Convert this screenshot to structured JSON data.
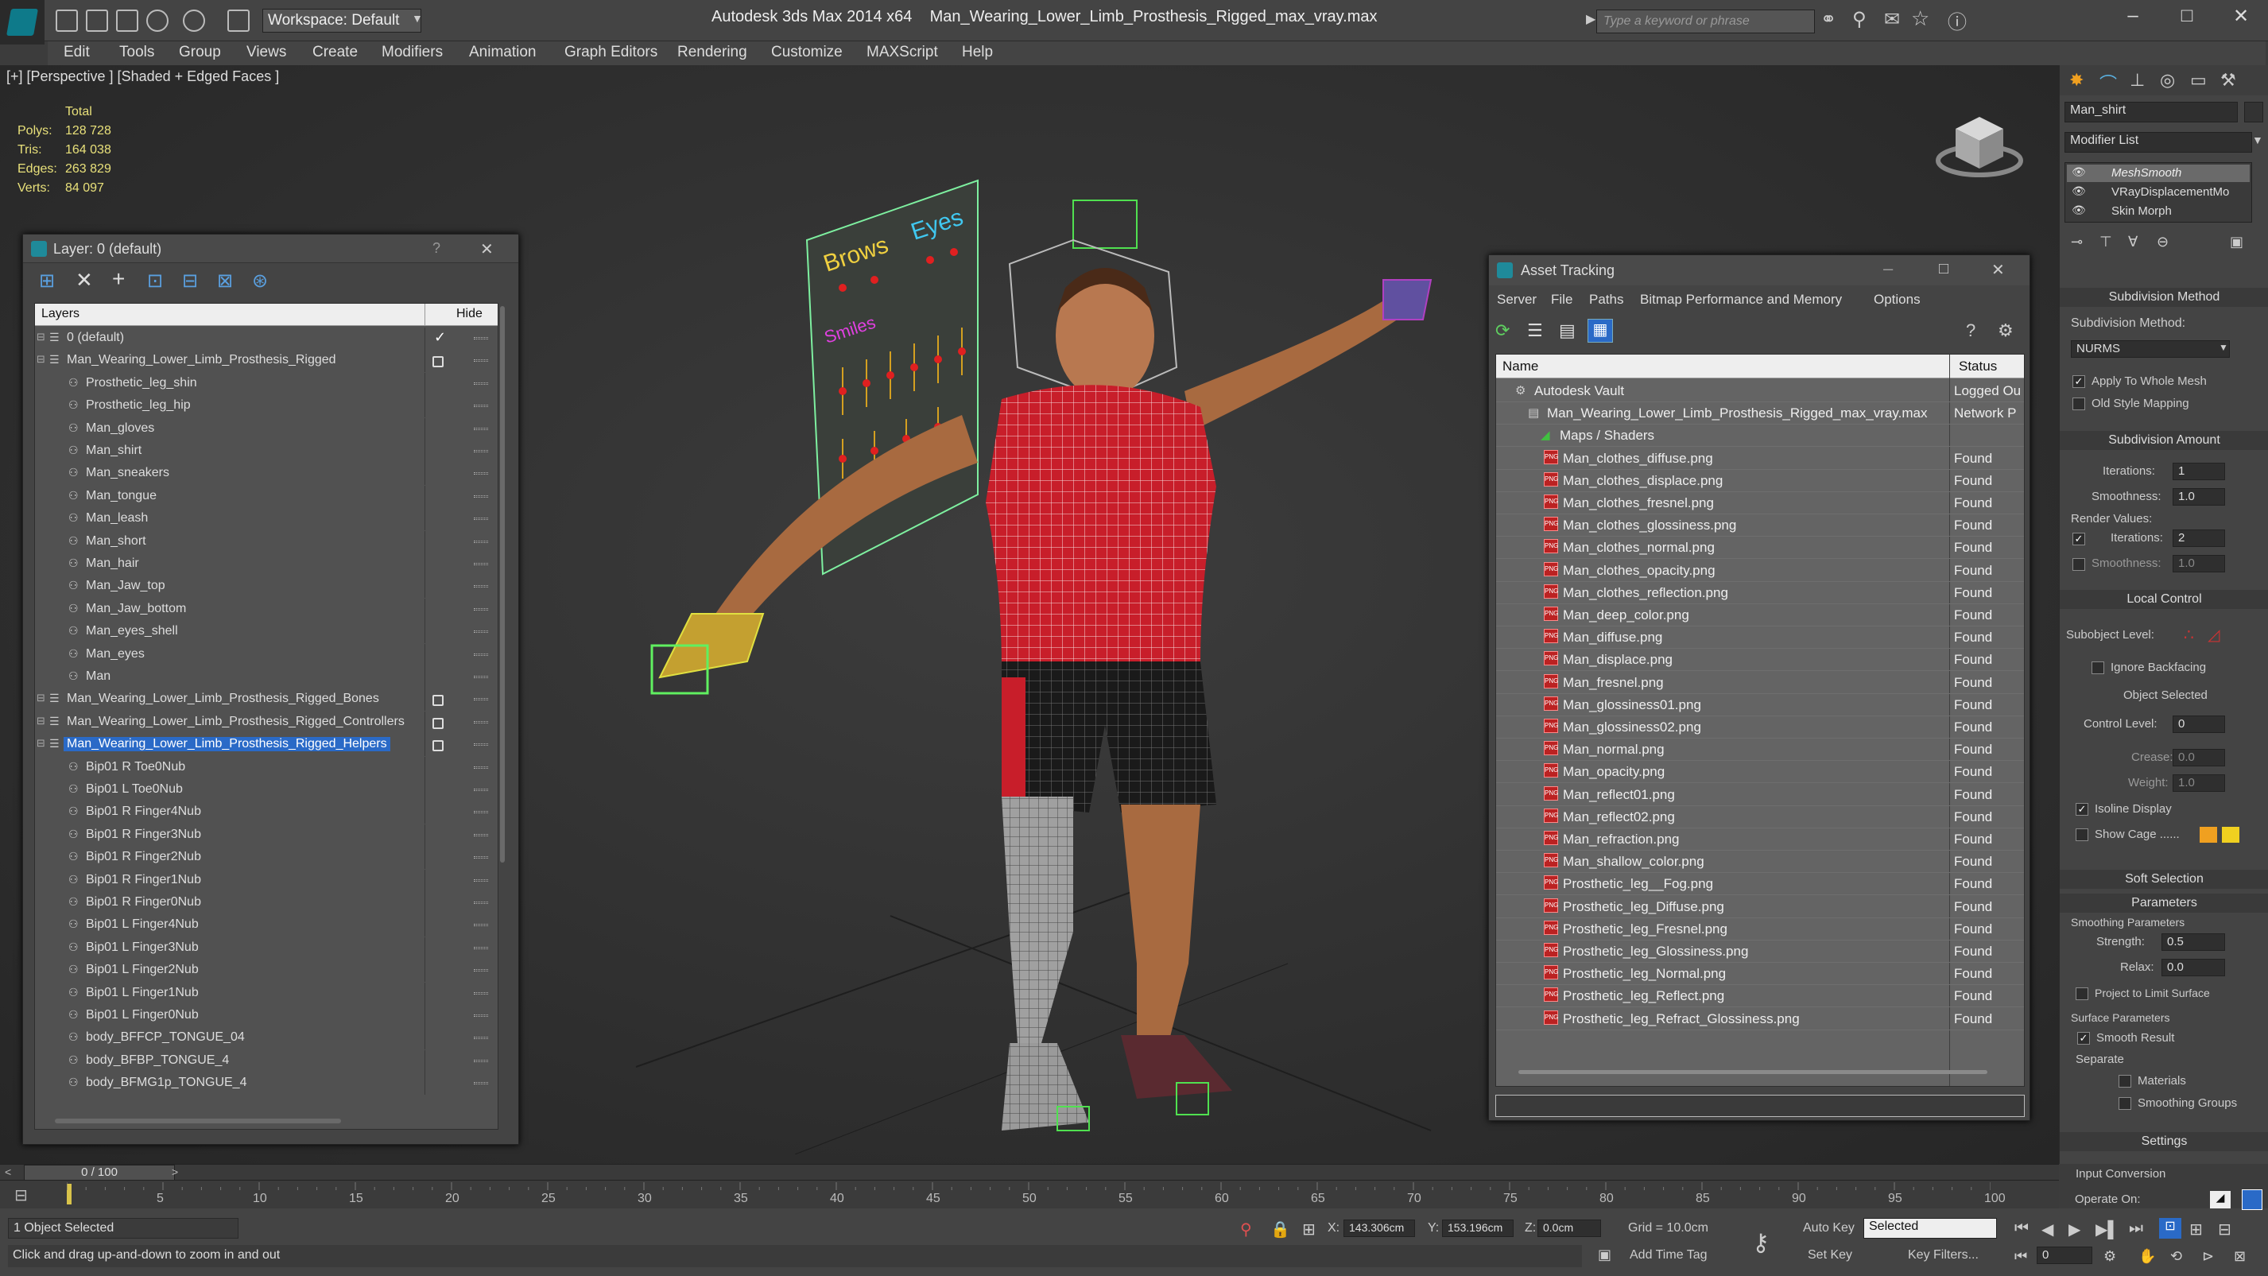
{
  "window": {
    "workspace_label": "Workspace: Default",
    "app_title": "Autodesk 3ds Max  2014 x64",
    "file_title": "Man_Wearing_Lower_Limb_Prosthesis_Rigged_max_vray.max",
    "search_placeholder": "Type a keyword or phrase"
  },
  "menubar": [
    "Edit",
    "Tools",
    "Group",
    "Views",
    "Create",
    "Modifiers",
    "Animation",
    "Graph Editors",
    "Rendering",
    "Customize",
    "MAXScript",
    "Help"
  ],
  "viewport": {
    "label": "[+] [Perspective ] [Shaded + Edged Faces ]",
    "stats": {
      "total_label": "Total",
      "rows": [
        {
          "label": "Polys:",
          "value": "128 728"
        },
        {
          "label": "Tris:",
          "value": "164 038"
        },
        {
          "label": "Edges:",
          "value": "263 829"
        },
        {
          "label": "Verts:",
          "value": "84 097"
        }
      ]
    },
    "face_board": {
      "brows": "Brows",
      "eyes": "Eyes",
      "smiles": "Smiles"
    }
  },
  "layer_window": {
    "title": "Layer: 0 (default)",
    "help": "?",
    "close": "✕",
    "col_layers": "Layers",
    "col_hide": "Hide",
    "rows": [
      {
        "name": "0 (default)",
        "level": 0,
        "check": true
      },
      {
        "name": "Man_Wearing_Lower_Limb_Prosthesis_Rigged",
        "level": 0,
        "box": true
      },
      {
        "name": "Prosthetic_leg_shin",
        "level": 1
      },
      {
        "name": "Prosthetic_leg_hip",
        "level": 1
      },
      {
        "name": "Man_gloves",
        "level": 1
      },
      {
        "name": "Man_shirt",
        "level": 1
      },
      {
        "name": "Man_sneakers",
        "level": 1
      },
      {
        "name": "Man_tongue",
        "level": 1
      },
      {
        "name": "Man_leash",
        "level": 1
      },
      {
        "name": "Man_short",
        "level": 1
      },
      {
        "name": "Man_hair",
        "level": 1
      },
      {
        "name": "Man_Jaw_top",
        "level": 1
      },
      {
        "name": "Man_Jaw_bottom",
        "level": 1
      },
      {
        "name": "Man_eyes_shell",
        "level": 1
      },
      {
        "name": "Man_eyes",
        "level": 1
      },
      {
        "name": "Man",
        "level": 1
      },
      {
        "name": "Man_Wearing_Lower_Limb_Prosthesis_Rigged_Bones",
        "level": 0,
        "box": true
      },
      {
        "name": "Man_Wearing_Lower_Limb_Prosthesis_Rigged_Controllers",
        "level": 0,
        "box": true
      },
      {
        "name": "Man_Wearing_Lower_Limb_Prosthesis_Rigged_Helpers",
        "level": 0,
        "box": true,
        "selected": true
      },
      {
        "name": "Bip01 R Toe0Nub",
        "level": 1
      },
      {
        "name": "Bip01 L Toe0Nub",
        "level": 1
      },
      {
        "name": "Bip01 R Finger4Nub",
        "level": 1
      },
      {
        "name": "Bip01 R Finger3Nub",
        "level": 1
      },
      {
        "name": "Bip01 R Finger2Nub",
        "level": 1
      },
      {
        "name": "Bip01 R Finger1Nub",
        "level": 1
      },
      {
        "name": "Bip01 R Finger0Nub",
        "level": 1
      },
      {
        "name": "Bip01 L Finger4Nub",
        "level": 1
      },
      {
        "name": "Bip01 L Finger3Nub",
        "level": 1
      },
      {
        "name": "Bip01 L Finger2Nub",
        "level": 1
      },
      {
        "name": "Bip01 L Finger1Nub",
        "level": 1
      },
      {
        "name": "Bip01 L Finger0Nub",
        "level": 1
      },
      {
        "name": "body_BFFCP_TONGUE_04",
        "level": 1
      },
      {
        "name": "body_BFBP_TONGUE_4",
        "level": 1
      },
      {
        "name": "body_BFMG1p_TONGUE_4",
        "level": 1
      }
    ]
  },
  "asset_window": {
    "title": "Asset Tracking",
    "menus": [
      "Server",
      "File",
      "Paths",
      "Bitmap Performance and Memory",
      "Options"
    ],
    "col_name": "Name",
    "col_status": "Status",
    "rows": [
      {
        "name": "Autodesk Vault",
        "status": "Logged Ou",
        "level": 0
      },
      {
        "name": "Man_Wearing_Lower_Limb_Prosthesis_Rigged_max_vray.max",
        "status": "Network P",
        "level": 1
      },
      {
        "name": "Maps / Shaders",
        "status": "",
        "level": 2
      },
      {
        "name": "Man_clothes_diffuse.png",
        "status": "Found",
        "level": 3
      },
      {
        "name": "Man_clothes_displace.png",
        "status": "Found",
        "level": 3
      },
      {
        "name": "Man_clothes_fresnel.png",
        "status": "Found",
        "level": 3
      },
      {
        "name": "Man_clothes_glossiness.png",
        "status": "Found",
        "level": 3
      },
      {
        "name": "Man_clothes_normal.png",
        "status": "Found",
        "level": 3
      },
      {
        "name": "Man_clothes_opacity.png",
        "status": "Found",
        "level": 3
      },
      {
        "name": "Man_clothes_reflection.png",
        "status": "Found",
        "level": 3
      },
      {
        "name": "Man_deep_color.png",
        "status": "Found",
        "level": 3
      },
      {
        "name": "Man_diffuse.png",
        "status": "Found",
        "level": 3
      },
      {
        "name": "Man_displace.png",
        "status": "Found",
        "level": 3
      },
      {
        "name": "Man_fresnel.png",
        "status": "Found",
        "level": 3
      },
      {
        "name": "Man_glossiness01.png",
        "status": "Found",
        "level": 3
      },
      {
        "name": "Man_glossiness02.png",
        "status": "Found",
        "level": 3
      },
      {
        "name": "Man_normal.png",
        "status": "Found",
        "level": 3
      },
      {
        "name": "Man_opacity.png",
        "status": "Found",
        "level": 3
      },
      {
        "name": "Man_reflect01.png",
        "status": "Found",
        "level": 3
      },
      {
        "name": "Man_reflect02.png",
        "status": "Found",
        "level": 3
      },
      {
        "name": "Man_refraction.png",
        "status": "Found",
        "level": 3
      },
      {
        "name": "Man_shallow_color.png",
        "status": "Found",
        "level": 3
      },
      {
        "name": "Prosthetic_leg__Fog.png",
        "status": "Found",
        "level": 3
      },
      {
        "name": "Prosthetic_leg_Diffuse.png",
        "status": "Found",
        "level": 3
      },
      {
        "name": "Prosthetic_leg_Fresnel.png",
        "status": "Found",
        "level": 3
      },
      {
        "name": "Prosthetic_leg_Glossiness.png",
        "status": "Found",
        "level": 3
      },
      {
        "name": "Prosthetic_leg_Normal.png",
        "status": "Found",
        "level": 3
      },
      {
        "name": "Prosthetic_leg_Reflect.png",
        "status": "Found",
        "level": 3
      },
      {
        "name": "Prosthetic_leg_Refract_Glossiness.png",
        "status": "Found",
        "level": 3
      }
    ]
  },
  "command_panel": {
    "object_name": "Man_shirt",
    "modifier_list": "Modifier List",
    "stack": [
      "MeshSmooth",
      "VRayDisplacementMo",
      "Skin Morph"
    ],
    "subdivision_method_title": "Subdivision Method",
    "subdivision_method_label": "Subdivision Method:",
    "subdivision_method_value": "NURMS",
    "apply_whole_mesh": "Apply To Whole Mesh",
    "old_style_mapping": "Old Style Mapping",
    "subdivision_amount_title": "Subdivision Amount",
    "iterations_label": "Iterations:",
    "iterations_value": "1",
    "smoothness_label": "Smoothness:",
    "smoothness_value": "1.0",
    "render_values_label": "Render Values:",
    "r_iterations_label": "Iterations:",
    "r_iterations_value": "2",
    "r_smoothness_label": "Smoothness:",
    "r_smoothness_value": "1.0",
    "local_control_title": "Local Control",
    "subobject_level_label": "Subobject Level:",
    "ignore_backfacing": "Ignore Backfacing",
    "object_selected": "Object Selected",
    "control_level_label": "Control Level:",
    "control_level_value": "0",
    "crease_label": "Crease:",
    "crease_value": "0.0",
    "weight_label": "Weight:",
    "weight_value": "1.0",
    "isoline_display": "Isoline Display",
    "show_cage": "Show Cage ......",
    "soft_selection_title": "Soft Selection",
    "parameters_title": "Parameters",
    "smoothing_params_label": "Smoothing Parameters",
    "strength_label": "Strength:",
    "strength_value": "0.5",
    "relax_label": "Relax:",
    "relax_value": "0.0",
    "project_limit": "Project to Limit Surface",
    "surface_params_label": "Surface Parameters",
    "smooth_result": "Smooth Result",
    "separate_label": "Separate",
    "materials": "Materials",
    "smoothing_groups": "Smoothing Groups",
    "settings_title": "Settings",
    "input_conversion_label": "Input Conversion",
    "operate_on_label": "Operate On:"
  },
  "timeline": {
    "frame_counter": "0 / 100",
    "ticks": [
      "5",
      "10",
      "15",
      "20",
      "25",
      "30",
      "35",
      "40",
      "45",
      "50",
      "55",
      "60",
      "65",
      "70",
      "75",
      "80",
      "85",
      "90",
      "95",
      "100"
    ]
  },
  "status": {
    "selection": "1 Object Selected",
    "prompt": "Click and drag up-and-down to zoom in and out",
    "x_label": "X:",
    "x_value": "143.306cm",
    "y_label": "Y:",
    "y_value": "153.196cm",
    "z_label": "Z:",
    "z_value": "0.0cm",
    "grid": "Grid = 10.0cm",
    "add_time_tag": "Add Time Tag",
    "auto_key": "Auto Key",
    "set_key": "Set Key",
    "key_mode": "Selected",
    "key_filters": "Key Filters...",
    "frame_value": "0"
  }
}
